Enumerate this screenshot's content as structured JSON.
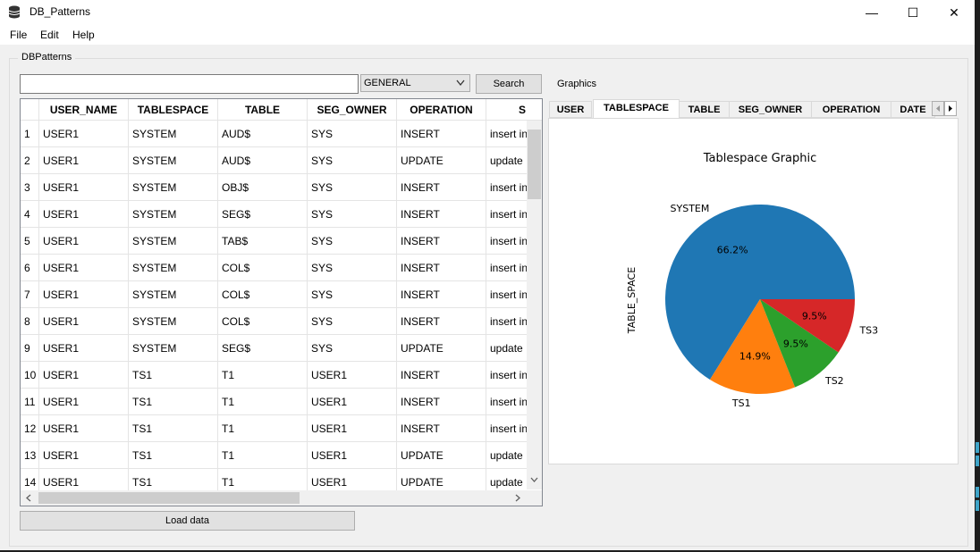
{
  "window": {
    "title": "DB_Patterns",
    "controls": [
      "—",
      "☐",
      "✕"
    ]
  },
  "menu": [
    "File",
    "Edit",
    "Help"
  ],
  "group_title": "DBPatterns",
  "search": {
    "value": "",
    "combo_value": "GENERAL",
    "button_label": "Search"
  },
  "table": {
    "columns": [
      "USER_NAME",
      "TABLESPACE",
      "TABLE",
      "SEG_OWNER",
      "OPERATION",
      "S"
    ],
    "rows": [
      [
        "1",
        "USER1",
        "SYSTEM",
        "AUD$",
        "SYS",
        "INSERT",
        "insert in"
      ],
      [
        "2",
        "USER1",
        "SYSTEM",
        "AUD$",
        "SYS",
        "UPDATE",
        "update"
      ],
      [
        "3",
        "USER1",
        "SYSTEM",
        "OBJ$",
        "SYS",
        "INSERT",
        "insert in"
      ],
      [
        "4",
        "USER1",
        "SYSTEM",
        "SEG$",
        "SYS",
        "INSERT",
        "insert in"
      ],
      [
        "5",
        "USER1",
        "SYSTEM",
        "TAB$",
        "SYS",
        "INSERT",
        "insert in"
      ],
      [
        "6",
        "USER1",
        "SYSTEM",
        "COL$",
        "SYS",
        "INSERT",
        "insert in"
      ],
      [
        "7",
        "USER1",
        "SYSTEM",
        "COL$",
        "SYS",
        "INSERT",
        "insert in"
      ],
      [
        "8",
        "USER1",
        "SYSTEM",
        "COL$",
        "SYS",
        "INSERT",
        "insert in"
      ],
      [
        "9",
        "USER1",
        "SYSTEM",
        "SEG$",
        "SYS",
        "UPDATE",
        "update"
      ],
      [
        "10",
        "USER1",
        "TS1",
        "T1",
        "USER1",
        "INSERT",
        "insert in"
      ],
      [
        "11",
        "USER1",
        "TS1",
        "T1",
        "USER1",
        "INSERT",
        "insert in"
      ],
      [
        "12",
        "USER1",
        "TS1",
        "T1",
        "USER1",
        "INSERT",
        "insert in"
      ],
      [
        "13",
        "USER1",
        "TS1",
        "T1",
        "USER1",
        "UPDATE",
        "update"
      ],
      [
        "14",
        "USER1",
        "TS1",
        "T1",
        "USER1",
        "UPDATE",
        "update"
      ]
    ]
  },
  "load_button": "Load data",
  "graphics_label": "Graphics",
  "tabs": [
    "USER",
    "TABLESPACE",
    "TABLE",
    "SEG_OWNER",
    "OPERATION",
    "DATE"
  ],
  "active_tab": "TABLESPACE",
  "chart_data": {
    "type": "pie",
    "title": "Tablespace Graphic",
    "ylabel": "TABLE_SPACE",
    "slices": [
      {
        "label": "SYSTEM",
        "value": 66.2,
        "pct_label": "66.2%",
        "color": "#1f77b4"
      },
      {
        "label": "TS1",
        "value": 14.9,
        "pct_label": "14.9%",
        "color": "#ff7f0e"
      },
      {
        "label": "TS2",
        "value": 9.5,
        "pct_label": "9.5%",
        "color": "#2ca02c"
      },
      {
        "label": "TS3",
        "value": 9.5,
        "pct_label": "9.5%",
        "color": "#d62728"
      }
    ]
  }
}
